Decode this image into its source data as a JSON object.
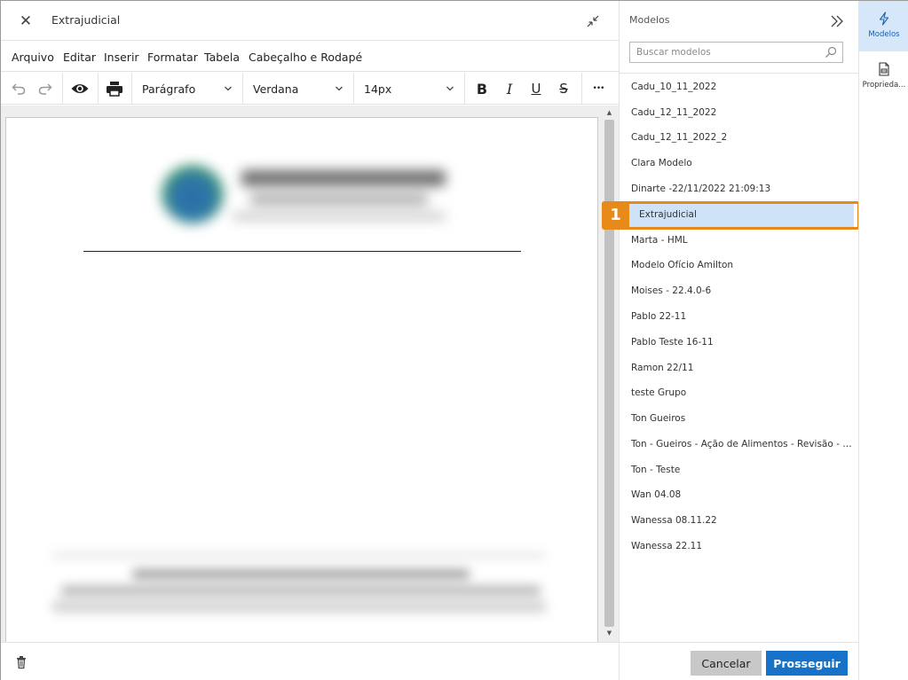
{
  "editor": {
    "title": "Extrajudicial",
    "menu": [
      "Arquivo",
      "Editar",
      "Inserir",
      "Formatar",
      "Tabela",
      "Cabeçalho e Rodapé"
    ],
    "toolbar": {
      "block_format": "Parágrafo",
      "font_family": "Verdana",
      "font_size": "14px",
      "bold_glyph": "B",
      "italic_glyph": "I",
      "underline_glyph": "U",
      "strike_glyph": "S",
      "more_glyph": "•••"
    }
  },
  "models_panel": {
    "title": "Modelos",
    "search_placeholder": "Buscar modelos",
    "items": [
      "Cadu_10_11_2022",
      "Cadu_12_11_2022",
      "Cadu_12_11_2022_2",
      "Clara Modelo",
      "Dinarte -22/11/2022 21:09:13",
      "Extrajudicial",
      "Marta - HML",
      "Modelo Ofício Amilton",
      "Moises - 22.4.0-6",
      "Pablo 22-11",
      "Pablo Teste 16-11",
      "Ramon 22/11",
      "teste Grupo",
      "Ton Gueiros",
      "Ton - Gueiros - Ação de Alimentos - Revisão - Gueiros",
      "Ton - Teste",
      "Wan 04.08",
      "Wanessa 08.11.22",
      "Wanessa 22.11"
    ],
    "selected_item": "Extrajudicial",
    "cancel_label": "Cancelar",
    "continue_label": "Prosseguir"
  },
  "callout": {
    "number": "1",
    "color": "#e88a1a"
  },
  "rail": {
    "tabs": [
      {
        "label": "Modelos",
        "icon": "lightning-icon",
        "active": true
      },
      {
        "label": "Proprieda...",
        "icon": "document-properties-icon",
        "active": false
      }
    ]
  },
  "colors": {
    "accent": "#1572c8",
    "selected_bg": "#cfe3f8",
    "rail_active_bg": "#d6e7f9"
  }
}
